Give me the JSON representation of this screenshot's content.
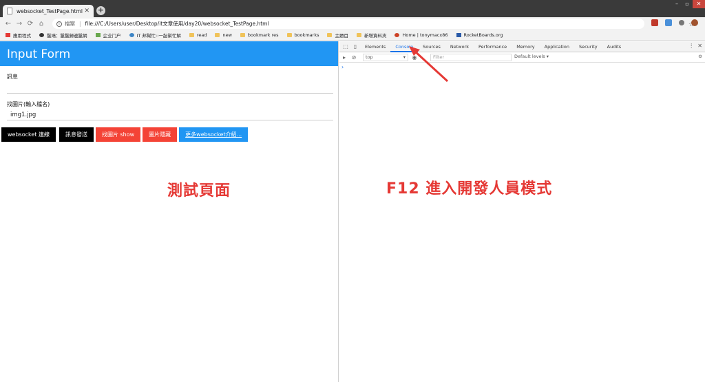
{
  "browser": {
    "tab_title": "websocket_TestPage.html",
    "address_scheme": "檔案",
    "url": "file:///C:/Users/user/Desktop/it文章使用/day20/websocket_TestPage.html",
    "bookmarks": [
      "應用程式",
      "鬣鳩：鬣鬣歸邊鬣網",
      "企业门户",
      "IT 邦幫忙::一起幫忙解",
      "read",
      "new",
      "bookmark res",
      "bookmarks",
      "主題目",
      "新增資料夾",
      "Home | tonymacx86",
      "RocketBoards.org"
    ]
  },
  "page": {
    "header": "Input Form",
    "msg_label": "訊息",
    "msg_value": "",
    "img_label": "找圖片(輸入檔名)",
    "img_value": "img1.jpg",
    "buttons": {
      "connect": "websocket 連線",
      "send": "訊息發送",
      "show": "找圖片 show",
      "hide": "圖片隱藏",
      "more": "更多websocket介紹..."
    }
  },
  "annotations": {
    "left": "測試頁面",
    "right": "F12 進入開發人員模式"
  },
  "devtools": {
    "tabs": [
      "Elements",
      "Console",
      "Sources",
      "Network",
      "Performance",
      "Memory",
      "Application",
      "Security",
      "Audits"
    ],
    "active_tab": "Console",
    "context": "top",
    "filter_placeholder": "Filter",
    "levels": "Default levels ▾",
    "prompt": "›"
  },
  "colors": {
    "header": "#2196f3",
    "button_red": "#f44336",
    "button_black": "#000000",
    "button_blue": "#2196f3",
    "annotation": "#e53935"
  }
}
